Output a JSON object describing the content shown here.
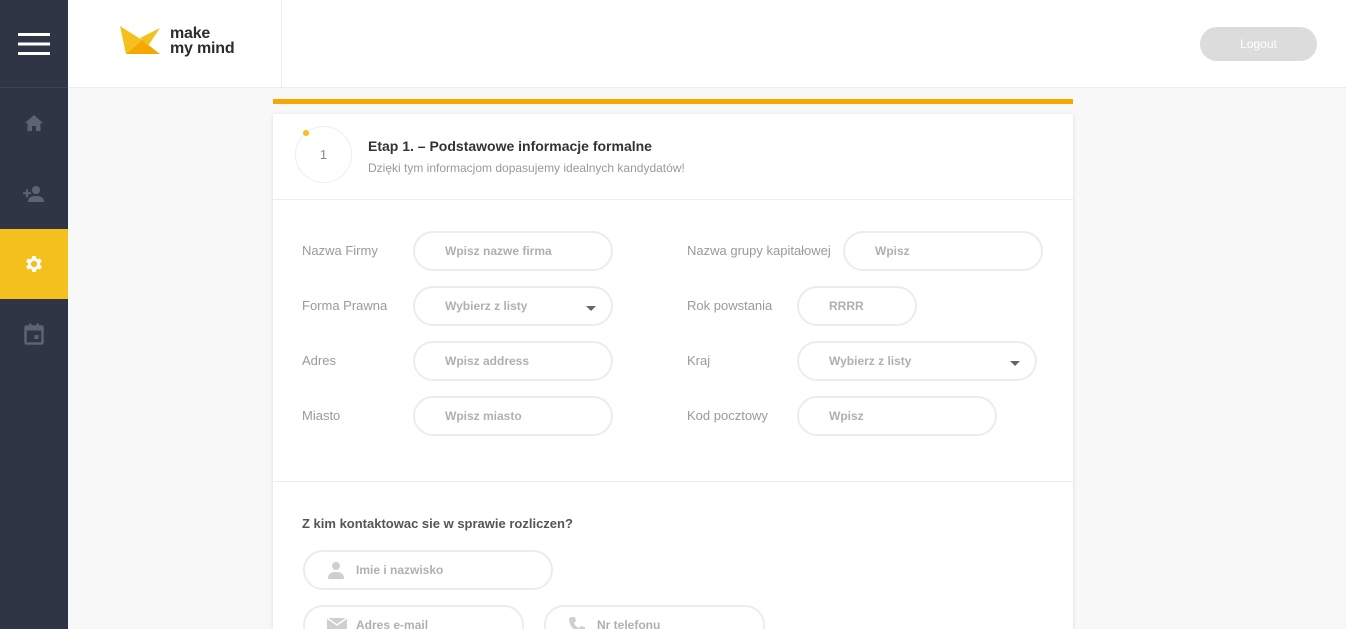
{
  "header": {
    "logo_line1": "make",
    "logo_line2": "my mind",
    "logout_label": "Logout"
  },
  "sidebar": {
    "items": [
      {
        "name": "home",
        "icon": "home-icon",
        "active": false
      },
      {
        "name": "add-user",
        "icon": "person-add-icon",
        "active": false
      },
      {
        "name": "settings",
        "icon": "gear-icon",
        "active": true
      },
      {
        "name": "calendar",
        "icon": "calendar-icon",
        "active": false
      }
    ]
  },
  "colors": {
    "sidebar_bg": "#2f3544",
    "accent": "#f4c01e",
    "accent_bar": "#f6a800"
  },
  "step": {
    "number": "1",
    "title": "Etap 1. – Podstawowe informacje formalne",
    "subtitle": "Dzięki tym informacjom dopasujemy idealnych kandydatów!"
  },
  "form": {
    "company_name": {
      "label": "Nazwa Firmy",
      "placeholder": "Wpisz nazwe firma"
    },
    "capital_group": {
      "label": "Nazwa grupy kapitałowej",
      "placeholder": "Wpisz"
    },
    "legal_form": {
      "label": "Forma Prawna",
      "placeholder": "Wybierz z listy"
    },
    "founded_year": {
      "label": "Rok powstania",
      "placeholder": "RRRR"
    },
    "address": {
      "label": "Adres",
      "placeholder": "Wpisz address"
    },
    "country": {
      "label": "Kraj",
      "placeholder": "Wybierz z listy"
    },
    "city": {
      "label": "Miasto",
      "placeholder": "Wpisz miasto"
    },
    "postal_code": {
      "label": "Kod pocztowy",
      "placeholder": "Wpisz"
    }
  },
  "contact": {
    "question": "Z kim kontaktowac sie w sprawie rozliczen?",
    "name_placeholder": "Imie i nazwisko",
    "email_placeholder": "Adres e-mail",
    "phone_placeholder": "Nr telefonu"
  }
}
